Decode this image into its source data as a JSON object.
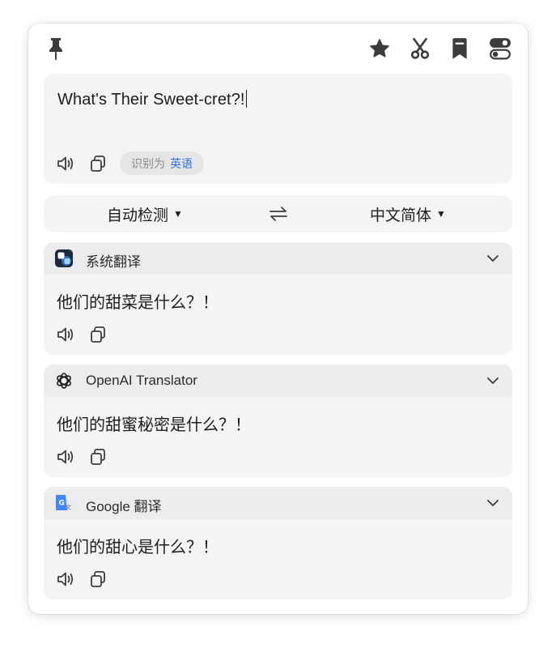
{
  "toolbar": {
    "icons": [
      "pin-icon",
      "star-icon",
      "scissors-icon",
      "bookmark-icon",
      "settings-toggle-icon"
    ]
  },
  "input": {
    "text": "What's Their Sweet-cret?!",
    "detect_prefix": "识别为",
    "detect_lang": "英语"
  },
  "lang_bar": {
    "source": "自动检测",
    "target": "中文简体"
  },
  "results": [
    {
      "service": "系统翻译",
      "text": "他们的甜菜是什么？！",
      "logo": "system-translate-logo-icon"
    },
    {
      "service": "OpenAI Translator",
      "text": "他们的甜蜜秘密是什么？！",
      "logo": "openai-logo-icon"
    },
    {
      "service": "Google 翻译",
      "text": "他们的甜心是什么？！",
      "logo": "google-translate-logo-icon"
    }
  ],
  "colors": {
    "accent": "#2f6fe0",
    "icon": "#3c3c3f",
    "card_bg": "#f4f4f5",
    "card_header_bg": "#ececee"
  }
}
